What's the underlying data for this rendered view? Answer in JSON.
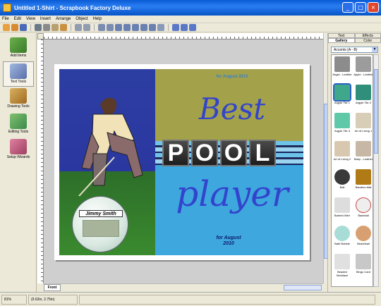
{
  "window": {
    "title": "Untitled 1-Shirt - Scrapbook Factory Deluxe"
  },
  "menu": [
    "File",
    "Edit",
    "View",
    "Insert",
    "Arrange",
    "Object",
    "Help"
  ],
  "tools": [
    {
      "label": "Add Items"
    },
    {
      "label": "Text Tools"
    },
    {
      "label": "Drawing Tools"
    },
    {
      "label": "Editing Tools"
    },
    {
      "label": "Setup Wizards"
    }
  ],
  "canvas": {
    "header_text": "for August 2010",
    "best": "Best",
    "pool_letters": [
      "P",
      "O",
      "O",
      "L"
    ],
    "player": "player",
    "for_august": "for August",
    "year": "2010",
    "name": "Jimmy Smith"
  },
  "page_tab": "Front",
  "right_panel": {
    "tabs_top": [
      "Text",
      "Effects"
    ],
    "tabs_bottom": [
      "Gallery",
      "Color"
    ],
    "dropdown": "Accents (A - B)",
    "items": [
      {
        "label": "Angel - Leather",
        "color": "#8c8c8c"
      },
      {
        "label": "Apple - Leather",
        "color": "#9c9c9c"
      },
      {
        "label": "Argyle Tile 1",
        "color": "#3fa88a"
      },
      {
        "label": "Argyle Tile 2",
        "color": "#2f8f7a"
      },
      {
        "label": "Argyle Tile 3",
        "color": "#5ec8a8"
      },
      {
        "label": "Art of Living 1",
        "color": "#d8ceb8"
      },
      {
        "label": "Art of Living 2",
        "color": "#d9c8b0"
      },
      {
        "label": "Baby - Leather",
        "color": "#c7b8a6"
      },
      {
        "label": "Ball",
        "color": "#3a3a3a"
      },
      {
        "label": "Bamboo Mat",
        "color": "#b07a16"
      },
      {
        "label": "Barbed Wire",
        "color": "#dddddd"
      },
      {
        "label": "Baseball",
        "color": "#eeeeee"
      },
      {
        "label": "Bath Bubble",
        "color": "#a8dcd6"
      },
      {
        "label": "Beachball",
        "color": "#d8a070"
      },
      {
        "label": "Beaded Necklace",
        "color": "#e0e0e0"
      },
      {
        "label": "Bingo Card",
        "color": "#c8c8c8"
      }
    ]
  },
  "status": {
    "zoom": "81%",
    "coords": "(9.62in, 2.75in)"
  }
}
